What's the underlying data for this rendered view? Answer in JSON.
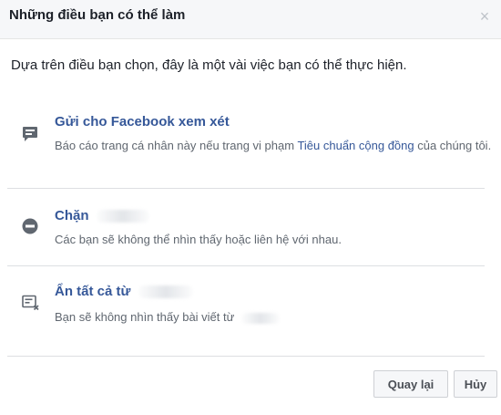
{
  "dialog": {
    "title": "Những điều bạn có thể làm",
    "close_label": "×"
  },
  "intro": "Dựa trên điều bạn chọn, đây là một vài việc bạn có thể thực hiện.",
  "options": [
    {
      "title": "Gửi cho Facebook xem xét",
      "description_prefix": "Báo cáo trang cá nhân này nếu trang vi phạm ",
      "description_link": "Tiêu chuẩn cộng đồng",
      "description_suffix": " của chúng tôi.",
      "icon": "report-page-icon"
    },
    {
      "title": "Chặn",
      "description": "Các bạn sẽ không thể nhìn thấy hoặc liên hệ với nhau.",
      "icon": "block-icon"
    },
    {
      "title": "Ẩn tất cả từ",
      "description": "Bạn sẽ không nhìn thấy bài viết từ",
      "icon": "hide-all-icon"
    }
  ],
  "buttons": {
    "back": "Quay lại",
    "cancel": "Hủy"
  },
  "colors": {
    "link": "#365899",
    "secondary_text": "#606770",
    "header_bg": "#f6f7f9"
  }
}
